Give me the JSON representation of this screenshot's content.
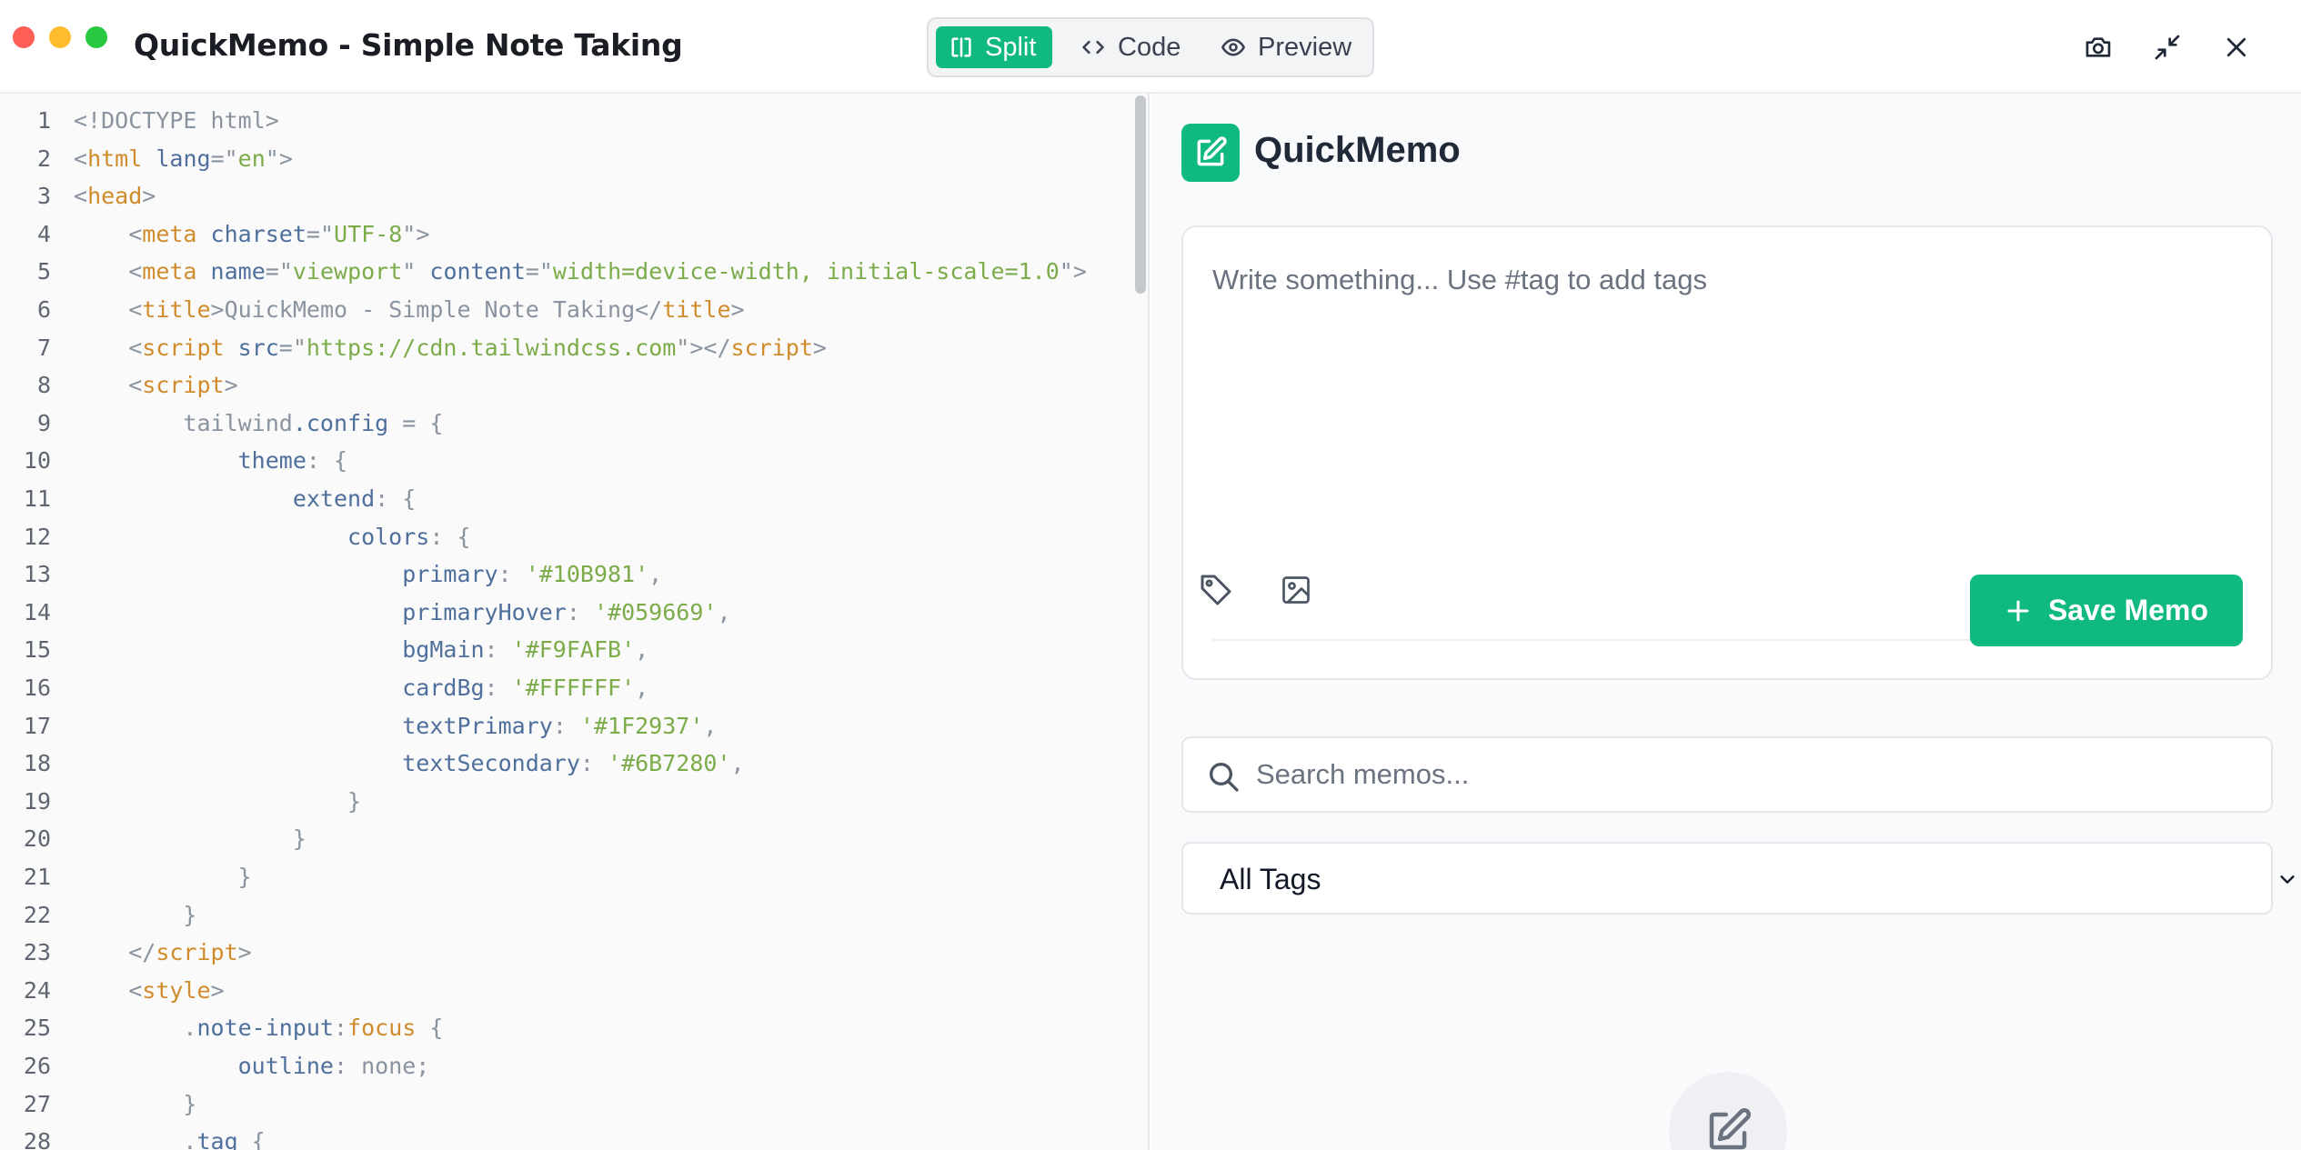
{
  "window": {
    "title": "QuickMemo - Simple Note Taking",
    "view_modes": [
      {
        "label": "Split",
        "active": true
      },
      {
        "label": "Code",
        "active": false
      },
      {
        "label": "Preview",
        "active": false
      }
    ],
    "controls": [
      "camera-icon",
      "minimize-icon",
      "close-icon"
    ]
  },
  "code_editor": {
    "lines": [
      {
        "n": "1",
        "tokens": [
          [
            "p",
            "<!DOCTYPE html>"
          ]
        ]
      },
      {
        "n": "2",
        "tokens": [
          [
            "p",
            "<"
          ],
          [
            "t",
            "html"
          ],
          [
            "p",
            " "
          ],
          [
            "a",
            "lang"
          ],
          [
            "p",
            "=\""
          ],
          [
            "s",
            "en"
          ],
          [
            "p",
            "\">"
          ]
        ]
      },
      {
        "n": "3",
        "tokens": [
          [
            "p",
            "<"
          ],
          [
            "t",
            "head"
          ],
          [
            "p",
            ">"
          ]
        ]
      },
      {
        "n": "4",
        "tokens": [
          [
            "p",
            "    <"
          ],
          [
            "t",
            "meta"
          ],
          [
            "p",
            " "
          ],
          [
            "a",
            "charset"
          ],
          [
            "p",
            "=\""
          ],
          [
            "s",
            "UTF-8"
          ],
          [
            "p",
            "\">"
          ]
        ]
      },
      {
        "n": "5",
        "tokens": [
          [
            "p",
            "    <"
          ],
          [
            "t",
            "meta"
          ],
          [
            "p",
            " "
          ],
          [
            "a",
            "name"
          ],
          [
            "p",
            "=\""
          ],
          [
            "s",
            "viewport"
          ],
          [
            "p",
            "\" "
          ],
          [
            "a",
            "content"
          ],
          [
            "p",
            "=\""
          ],
          [
            "s",
            "width=device-width, initial-scale=1.0"
          ],
          [
            "p",
            "\">"
          ]
        ]
      },
      {
        "n": "6",
        "tokens": [
          [
            "p",
            "    <"
          ],
          [
            "t",
            "title"
          ],
          [
            "p",
            ">QuickMemo - Simple Note Taking</"
          ],
          [
            "t",
            "title"
          ],
          [
            "p",
            ">"
          ]
        ]
      },
      {
        "n": "7",
        "tokens": [
          [
            "p",
            "    <"
          ],
          [
            "t",
            "script"
          ],
          [
            "p",
            " "
          ],
          [
            "a",
            "src"
          ],
          [
            "p",
            "=\""
          ],
          [
            "s",
            "https://cdn.tailwindcss.com"
          ],
          [
            "p",
            "\"></"
          ],
          [
            "t",
            "script"
          ],
          [
            "p",
            ">"
          ]
        ]
      },
      {
        "n": "8",
        "tokens": [
          [
            "p",
            "    <"
          ],
          [
            "t",
            "script"
          ],
          [
            "p",
            ">"
          ]
        ]
      },
      {
        "n": "9",
        "tokens": [
          [
            "p",
            "        tailwind"
          ],
          [
            "r",
            ".config"
          ],
          [
            "p",
            " = {"
          ]
        ]
      },
      {
        "n": "10",
        "tokens": [
          [
            "p",
            "            "
          ],
          [
            "r",
            "theme"
          ],
          [
            "p",
            ": {"
          ]
        ]
      },
      {
        "n": "11",
        "tokens": [
          [
            "p",
            "                "
          ],
          [
            "r",
            "extend"
          ],
          [
            "p",
            ": {"
          ]
        ]
      },
      {
        "n": "12",
        "tokens": [
          [
            "p",
            "                    "
          ],
          [
            "r",
            "colors"
          ],
          [
            "p",
            ": {"
          ]
        ]
      },
      {
        "n": "13",
        "tokens": [
          [
            "p",
            "                        "
          ],
          [
            "r",
            "primary"
          ],
          [
            "p",
            ": "
          ],
          [
            "s",
            "'#10B981'"
          ],
          [
            "p",
            ","
          ]
        ]
      },
      {
        "n": "14",
        "tokens": [
          [
            "p",
            "                        "
          ],
          [
            "r",
            "primaryHover"
          ],
          [
            "p",
            ": "
          ],
          [
            "s",
            "'#059669'"
          ],
          [
            "p",
            ","
          ]
        ]
      },
      {
        "n": "15",
        "tokens": [
          [
            "p",
            "                        "
          ],
          [
            "r",
            "bgMain"
          ],
          [
            "p",
            ": "
          ],
          [
            "s",
            "'#F9FAFB'"
          ],
          [
            "p",
            ","
          ]
        ]
      },
      {
        "n": "16",
        "tokens": [
          [
            "p",
            "                        "
          ],
          [
            "r",
            "cardBg"
          ],
          [
            "p",
            ": "
          ],
          [
            "s",
            "'#FFFFFF'"
          ],
          [
            "p",
            ","
          ]
        ]
      },
      {
        "n": "17",
        "tokens": [
          [
            "p",
            "                        "
          ],
          [
            "r",
            "textPrimary"
          ],
          [
            "p",
            ": "
          ],
          [
            "s",
            "'#1F2937'"
          ],
          [
            "p",
            ","
          ]
        ]
      },
      {
        "n": "18",
        "tokens": [
          [
            "p",
            "                        "
          ],
          [
            "r",
            "textSecondary"
          ],
          [
            "p",
            ": "
          ],
          [
            "s",
            "'#6B7280'"
          ],
          [
            "p",
            ","
          ]
        ]
      },
      {
        "n": "19",
        "tokens": [
          [
            "p",
            "                    }"
          ]
        ]
      },
      {
        "n": "20",
        "tokens": [
          [
            "p",
            "                }"
          ]
        ]
      },
      {
        "n": "21",
        "tokens": [
          [
            "p",
            "            }"
          ]
        ]
      },
      {
        "n": "22",
        "tokens": [
          [
            "p",
            "        }"
          ]
        ]
      },
      {
        "n": "23",
        "tokens": [
          [
            "p",
            "    </"
          ],
          [
            "t",
            "script"
          ],
          [
            "p",
            ">"
          ]
        ]
      },
      {
        "n": "24",
        "tokens": [
          [
            "p",
            "    <"
          ],
          [
            "t",
            "style"
          ],
          [
            "p",
            ">"
          ]
        ]
      },
      {
        "n": "25",
        "tokens": [
          [
            "p",
            "        ."
          ],
          [
            "r",
            "note-input"
          ],
          [
            "p",
            ":"
          ],
          [
            "t",
            "focus"
          ],
          [
            "p",
            " {"
          ]
        ]
      },
      {
        "n": "26",
        "tokens": [
          [
            "p",
            "            "
          ],
          [
            "r",
            "outline"
          ],
          [
            "p",
            ": none;"
          ]
        ]
      },
      {
        "n": "27",
        "tokens": [
          [
            "p",
            "        }"
          ]
        ]
      },
      {
        "n": "28",
        "tokens": [
          [
            "p",
            "        ."
          ],
          [
            "r",
            "tag"
          ],
          [
            "p",
            " {"
          ]
        ]
      }
    ]
  },
  "preview": {
    "brand": "QuickMemo",
    "memo_input_placeholder": "Write something... Use #tag to add tags",
    "save_button_label": "Save Memo",
    "search_placeholder": "Search memos...",
    "tag_filter_selected": "All Tags",
    "accent_color": "#10B981"
  }
}
